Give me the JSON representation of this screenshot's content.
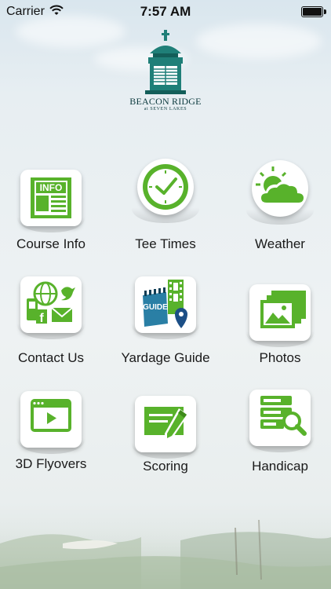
{
  "status_bar": {
    "carrier": "Carrier",
    "time": "7:57 AM",
    "battery_level": 1.0
  },
  "logo": {
    "title": "BEACON RIDGE",
    "subtitle": "at SEVEN LAKES"
  },
  "menu": [
    {
      "label": "Course Info",
      "icon": "info-newspaper-icon"
    },
    {
      "label": "Tee Times",
      "icon": "clock-icon"
    },
    {
      "label": "Weather",
      "icon": "sun-cloud-icon"
    },
    {
      "label": "Contact Us",
      "icon": "contact-social-icon"
    },
    {
      "label": "Yardage Guide",
      "icon": "guide-map-icon"
    },
    {
      "label": "Photos",
      "icon": "photos-icon"
    },
    {
      "label": "3D Flyovers",
      "icon": "video-player-icon"
    },
    {
      "label": "Scoring",
      "icon": "scorecard-pencil-icon"
    },
    {
      "label": "Handicap",
      "icon": "server-search-icon"
    }
  ],
  "colors": {
    "icon_green": "#58b22b",
    "logo_teal": "#1f7f78"
  }
}
